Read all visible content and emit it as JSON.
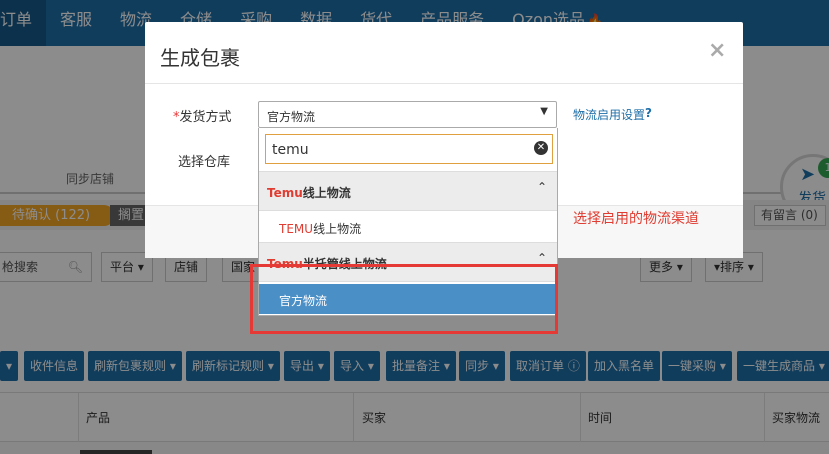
{
  "nav": {
    "items": [
      "订单",
      "客服",
      "物流",
      "仓储",
      "采购",
      "数据",
      "货代",
      "产品服务",
      "Ozon选品"
    ],
    "flame_icon": "flame-icon"
  },
  "steps": {
    "sync_label": "同步店铺",
    "ship_label": "发货",
    "ship_badge": "1"
  },
  "status": {
    "pending": "待确认 (122)",
    "next": "搁置",
    "messages": "有留言 (0)"
  },
  "filters": {
    "search_text": "枪搜索",
    "platform": "平台",
    "shop": "店铺",
    "country": "国家",
    "more": "更多",
    "sort": "排序"
  },
  "actions": {
    "first": "",
    "receipt": "收件信息",
    "refresh_rule": "刷新包裹规则",
    "refresh_mark": "刷新标记规则",
    "export": "导出",
    "import": "导入",
    "batch_note": "批量备注",
    "sync": "同步",
    "cancel_order": "取消订单",
    "blacklist": "加入黑名单",
    "purchase": "一键采购",
    "gen_product": "一键生成商品"
  },
  "table": {
    "col_product": "产品",
    "col_buyer": "买家",
    "col_time": "时间",
    "col_logistics": "买家物流"
  },
  "modal": {
    "title": "生成包裹",
    "close": "×",
    "req_mark": "*",
    "ship_method_label": "发货方式",
    "warehouse_label": "选择仓库",
    "selected_value": "官方物流",
    "help_link": "物流启用设置",
    "help_q": "?",
    "annotation": "选择启用的物流渠道"
  },
  "dropdown": {
    "search_value": "temu",
    "group1_prefix": "Temu",
    "group1_suffix": "线上物流",
    "option1_prefix": "TEMU",
    "option1_suffix": "线上物流",
    "group2_prefix": "Temu",
    "group2_suffix": "半托管线上物流",
    "option2": "官方物流"
  },
  "colors": {
    "nav_blue": "#1f6fa8",
    "accent_red": "#e03c31",
    "selected_blue": "#4b8fc7",
    "pending_orange": "#f5a623"
  }
}
